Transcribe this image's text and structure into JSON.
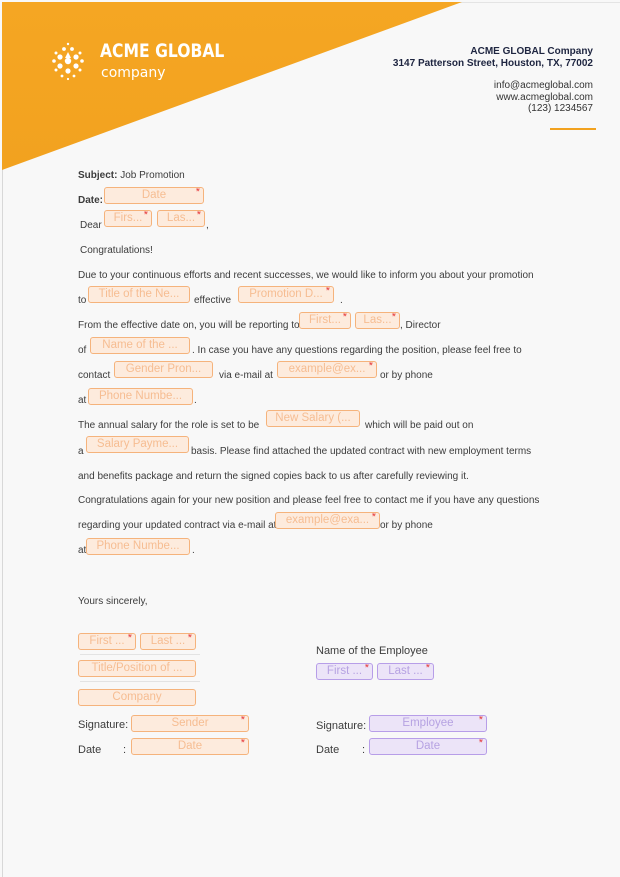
{
  "letterhead": {
    "brand_name": "ACME GLOBAL",
    "brand_sub": "company",
    "company_line": "ACME GLOBAL Company",
    "address_line": "3147 Patterson Street, Houston, TX, 77002",
    "email": "info@acmeglobal.com",
    "website": "www.acmeglobal.com",
    "phone": "(123) 1234567",
    "accent_color": "#f2a21f"
  },
  "letter": {
    "subject_label": "Subject:",
    "subject_value": "Job Promotion",
    "date_label": "Date:",
    "dear": "Dear",
    "comma": ",",
    "congrats": "Congratulations!",
    "p1_line1": "Due to your continuous efforts and recent successes, we would like to inform you about your promotion",
    "p1_to": "to",
    "p1_effective": "effective",
    "p1_period": ".",
    "p2_line1": "From the effective date on, you will be reporting to",
    "p2_director": ", Director",
    "p2_of": "of",
    "p2_rest": ". In case you have any questions regarding the position, please feel free to",
    "p2_contact": "contact",
    "p2_via": "via e-mail at",
    "p2_orphone": "or by phone",
    "p2_at": "at",
    "p2_period": ".",
    "p3_line1": "The annual salary for the role is set to be",
    "p3_paid": "which will be paid out on",
    "p3_a": "a",
    "p3_basis": "basis. Please find attached the updated contract with new employment terms",
    "p3_line3": "and benefits package and return the signed copies back to us after carefully reviewing it.",
    "p4_line1": "Congratulations again for your new position and please feel free to contact me if you have any questions",
    "p4_line2": "regarding your updated contract via e-mail at",
    "p4_orphone": "or by phone",
    "p4_at": "at",
    "p4_period": ".",
    "closing": "Yours sincerely,",
    "employee_heading": "Name of the Employee",
    "signature_label": "Signature:",
    "date_label2": "Date",
    "colon": ":"
  },
  "fields": {
    "date": {
      "placeholder": "Date",
      "required": true
    },
    "recipient_first": {
      "placeholder": "Firs...",
      "required": true
    },
    "recipient_last": {
      "placeholder": "Las...",
      "required": true
    },
    "new_title": {
      "placeholder": "Title of the Ne...",
      "required": false
    },
    "promotion_date": {
      "placeholder": "Promotion D...",
      "required": true
    },
    "manager_first": {
      "placeholder": "First...",
      "required": true
    },
    "manager_last": {
      "placeholder": "Las...",
      "required": true
    },
    "department": {
      "placeholder": "Name of the ...",
      "required": false
    },
    "gender_pronoun": {
      "placeholder": "Gender Pron...",
      "required": false
    },
    "manager_email": {
      "placeholder": "example@ex...",
      "required": true
    },
    "manager_phone": {
      "placeholder": "Phone Numbe...",
      "required": false
    },
    "new_salary": {
      "placeholder": "New Salary (...",
      "required": false
    },
    "salary_payment": {
      "placeholder": "Salary Payme...",
      "required": false
    },
    "sender_email": {
      "placeholder": "example@exa...",
      "required": true
    },
    "sender_phone": {
      "placeholder": "Phone Numbe...",
      "required": false
    },
    "sender_first": {
      "placeholder": "First ...",
      "required": true
    },
    "sender_last": {
      "placeholder": "Last ...",
      "required": true
    },
    "sender_title": {
      "placeholder": "Title/Position of ...",
      "required": false
    },
    "sender_company": {
      "placeholder": "Company",
      "required": false
    },
    "sender_signature": {
      "placeholder": "Sender",
      "required": true
    },
    "sender_date": {
      "placeholder": "Date",
      "required": true
    },
    "employee_first": {
      "placeholder": "First ...",
      "required": true
    },
    "employee_last": {
      "placeholder": "Last ...",
      "required": true
    },
    "employee_signature": {
      "placeholder": "Employee",
      "required": true
    },
    "employee_date": {
      "placeholder": "Date",
      "required": true
    }
  },
  "required_marker": "*"
}
